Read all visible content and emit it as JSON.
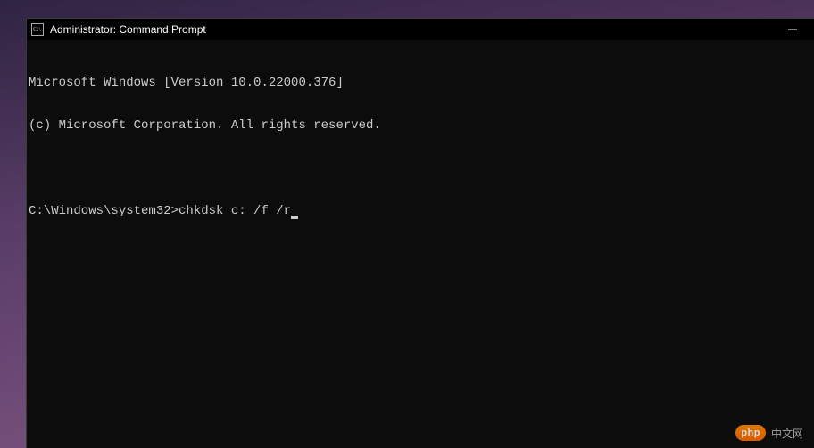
{
  "window": {
    "title": "Administrator: Command Prompt"
  },
  "terminal": {
    "line1": "Microsoft Windows [Version 10.0.22000.376]",
    "line2": "(c) Microsoft Corporation. All rights reserved.",
    "blank": "",
    "prompt": "C:\\Windows\\system32>",
    "command": "chkdsk c: /f /r"
  },
  "watermark": {
    "badge": "php",
    "text": "中文网"
  }
}
